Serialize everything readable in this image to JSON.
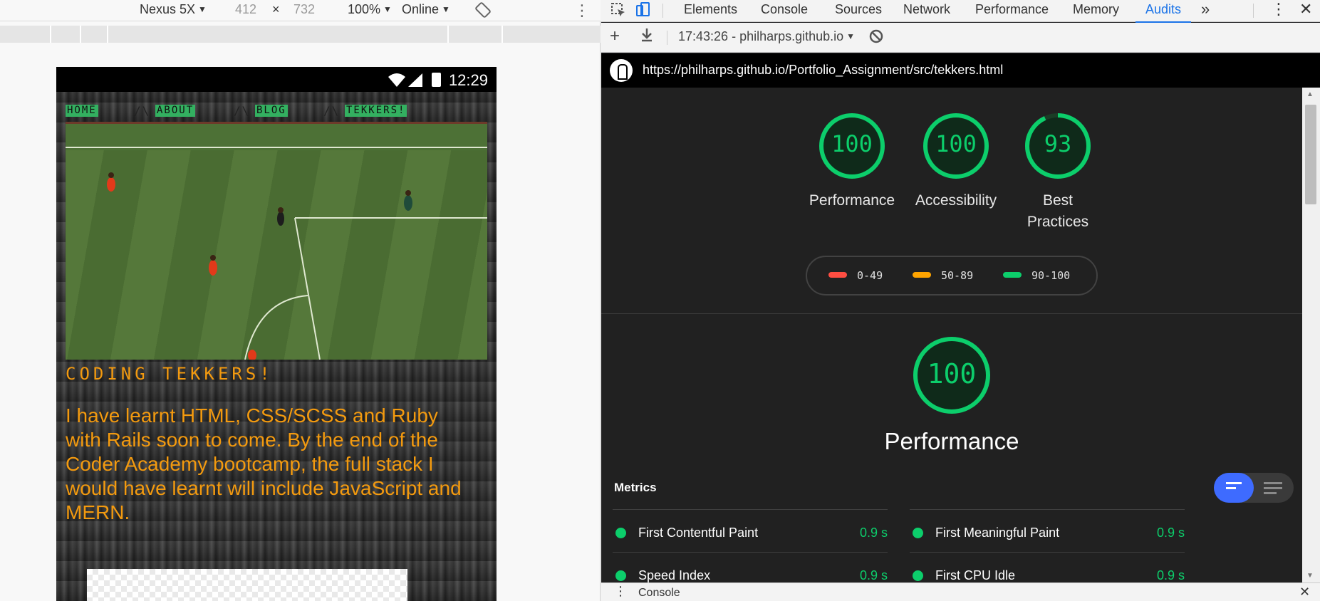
{
  "device_toolbar": {
    "device": "Nexus 5X",
    "width": "412",
    "times": "×",
    "height": "732",
    "zoom": "100%",
    "network": "Online"
  },
  "phone": {
    "time": "12:29",
    "site": {
      "nav": [
        {
          "label": "HOME"
        },
        {
          "label": "ABOUT"
        },
        {
          "label": "BLOG"
        },
        {
          "label": "TEKKERS!"
        }
      ],
      "nav_separator": "/\\",
      "heading": "Coding Tekkers!",
      "paragraph": "I have learnt HTML, CSS/SCSS and Ruby with Rails soon to come. By the end of the Coder Academy bootcamp, the full stack I would have learnt will include JavaScript and MERN."
    }
  },
  "devtools": {
    "tabs": [
      "Elements",
      "Console",
      "Sources",
      "Network",
      "Performance",
      "Memory",
      "Audits"
    ],
    "active_tab": "Audits",
    "more": "»",
    "audit_toolbar": {
      "add": "+",
      "run_label": "17:43:26 - philharps.github.io"
    },
    "report_url": "https://philharps.github.io/Portfolio_Assignment/src/tekkers.html",
    "gauges": [
      {
        "score": "100",
        "label": "Performance",
        "fraction": 1.0
      },
      {
        "score": "100",
        "label": "Accessibility",
        "fraction": 1.0
      },
      {
        "score": "93",
        "label": "Best Practices",
        "fraction": 0.93
      }
    ],
    "legend": [
      {
        "range": "0-49",
        "color": "#ff4e42"
      },
      {
        "range": "50-89",
        "color": "#ffa400"
      },
      {
        "range": "90-100",
        "color": "#0cce6b"
      }
    ],
    "category": {
      "score": "100",
      "title": "Performance",
      "fraction": 1.0
    },
    "metrics_title": "Metrics",
    "metrics": [
      {
        "name": "First Contentful Paint",
        "value": "0.9 s"
      },
      {
        "name": "First Meaningful Paint",
        "value": "0.9 s"
      },
      {
        "name": "Speed Index",
        "value": "0.9 s"
      },
      {
        "name": "First CPU Idle",
        "value": "0.9 s"
      }
    ],
    "drawer_label": "Console",
    "pass_color": "#0cce6b",
    "accent_color": "#1a73e8"
  }
}
